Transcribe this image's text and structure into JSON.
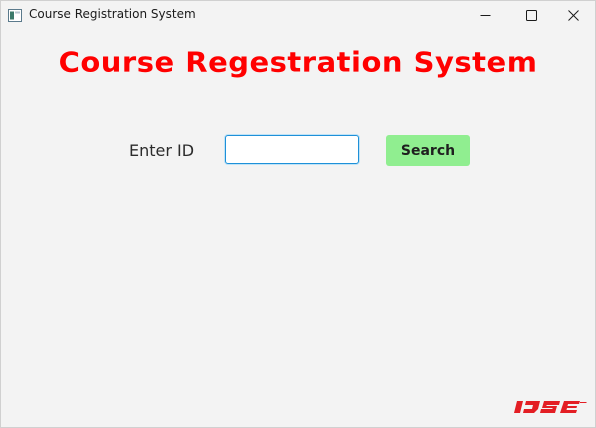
{
  "window": {
    "title": "Course Registration System"
  },
  "titlebar_controls": {
    "minimize_icon": "minimize-icon",
    "maximize_icon": "maximize-icon",
    "close_icon": "close-icon"
  },
  "main": {
    "heading": "Course Regestration System",
    "id_label": "Enter ID",
    "id_input_value": "",
    "search_label": "Search"
  },
  "logo": {
    "text": "IJSE"
  },
  "colors": {
    "heading": "#ff0000",
    "search_button": "#90ee90",
    "input_focus_border": "#1e90d8",
    "logo": "#e31e24",
    "background": "#f3f3f3"
  }
}
